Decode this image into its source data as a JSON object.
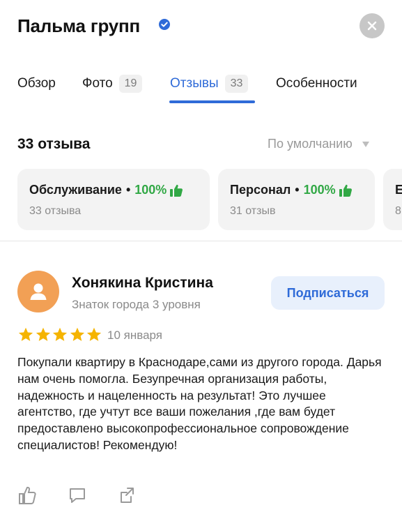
{
  "header": {
    "title": "Пальма групп",
    "verified_icon": "verified-badge-icon",
    "close_icon": "close-icon"
  },
  "tabs": [
    {
      "label": "Обзор",
      "count": ""
    },
    {
      "label": "Фото",
      "count": "19"
    },
    {
      "label": "Отзывы",
      "count": "33",
      "active": true
    },
    {
      "label": "Особенности",
      "count": ""
    }
  ],
  "reviews_summary": {
    "count_label": "33 отзыва",
    "sort_label": "По умолчанию"
  },
  "aspects": [
    {
      "title": "Обслуживание",
      "percent": "100%",
      "sub": "33 отзыва"
    },
    {
      "title": "Персонал",
      "percent": "100%",
      "sub": "31 отзыв"
    },
    {
      "title": "Е",
      "percent": "",
      "sub": "8"
    }
  ],
  "review": {
    "author": "Хонякина Кристина",
    "level": "Знаток города 3 уровня",
    "subscribe_label": "Подписаться",
    "rating": 5,
    "date": "10 января",
    "text": "Покупали квартиру в Краснодаре,сами из другого города. Дарья нам очень помогла. Безупречная организация работы, надежность и нацеленность на результат! Это лучшее агентство, где учтут все ваши пожелания ,где вам будет предоставлено высокопрофессиональное сопровождение специалистов! Рекомендую!"
  },
  "colors": {
    "accent": "#2f6bd8",
    "positive": "#31a845",
    "star": "#f5b400",
    "avatar_bg": "#f2a055"
  }
}
